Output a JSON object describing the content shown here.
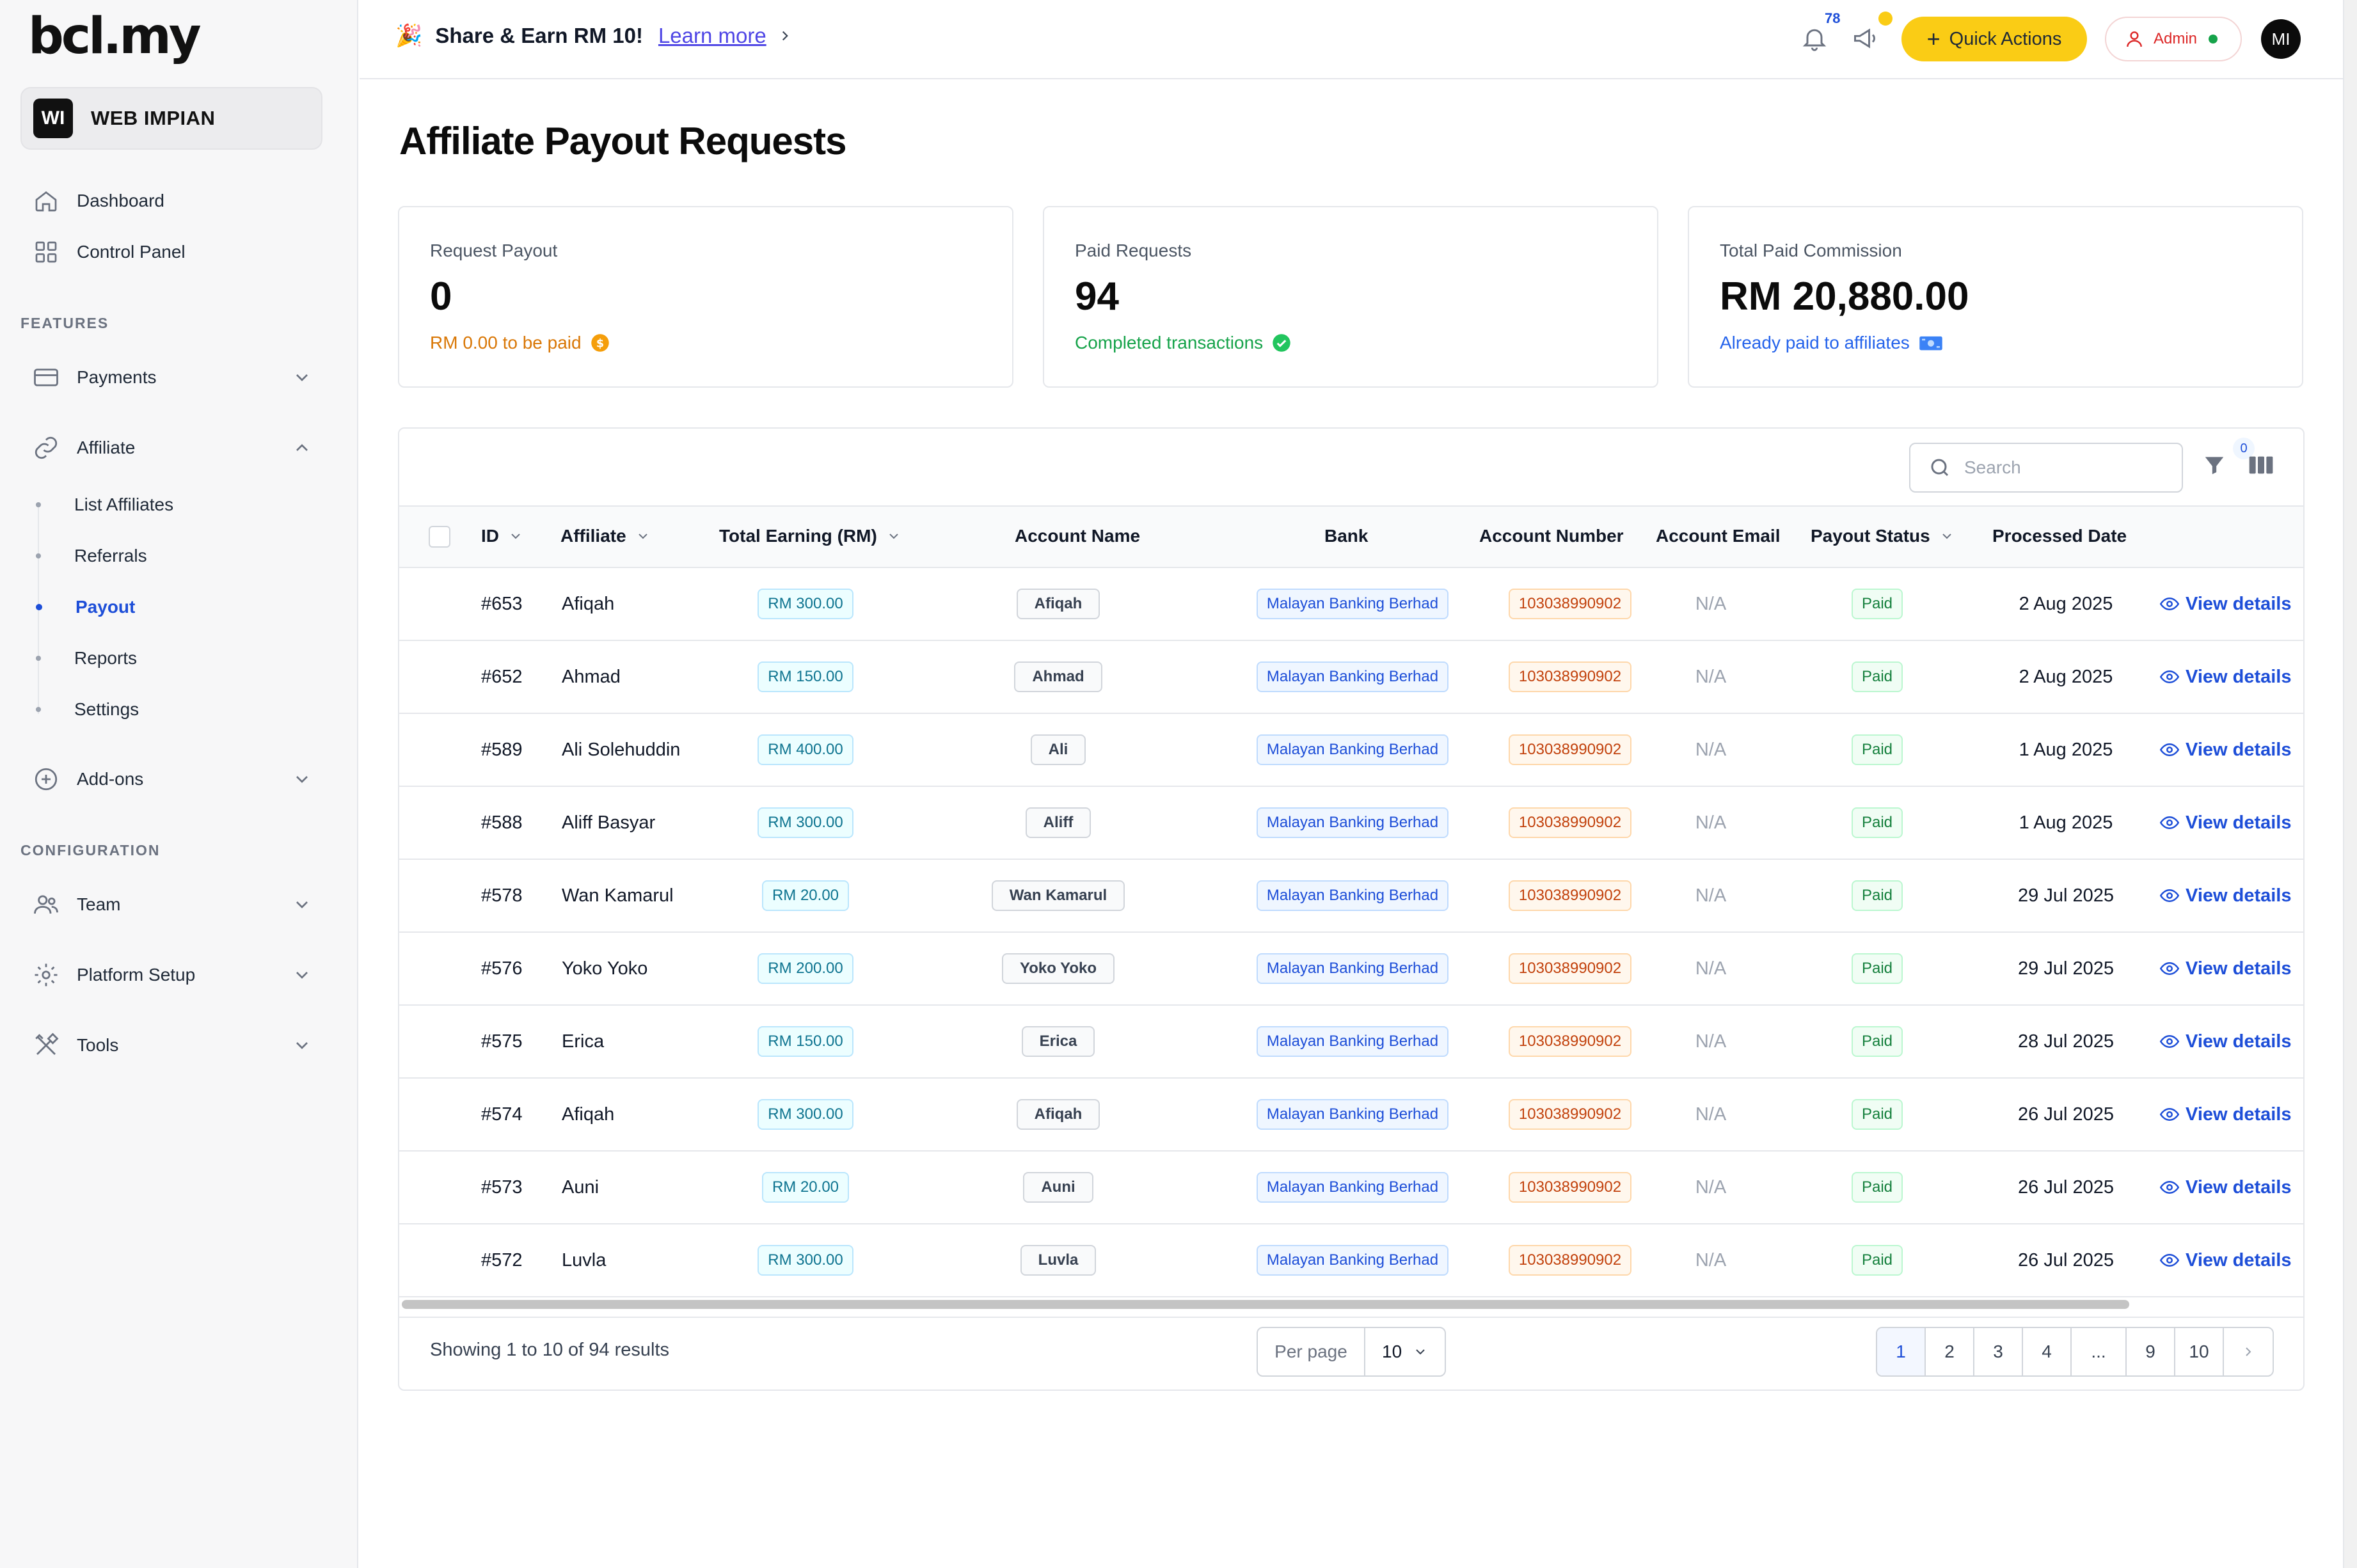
{
  "app": {
    "logo": "bcl.my",
    "workspace": {
      "initials": "WI",
      "name": "WEB IMPIAN"
    }
  },
  "sidebar": {
    "dashboard": "Dashboard",
    "control_panel": "Control Panel",
    "features_label": "FEATURES",
    "payments": "Payments",
    "affiliate": "Affiliate",
    "affiliate_sub": {
      "list": "List Affiliates",
      "referrals": "Referrals",
      "payout": "Payout",
      "reports": "Reports",
      "settings": "Settings"
    },
    "addons": "Add-ons",
    "configuration_label": "CONFIGURATION",
    "team": "Team",
    "platform_setup": "Platform Setup",
    "tools": "Tools"
  },
  "topbar": {
    "promo_text": "Share & Earn RM 10!",
    "promo_link": "Learn more",
    "notification_count": "78",
    "quick_actions": "Quick Actions",
    "admin_label": "Admin",
    "avatar_initials": "MI"
  },
  "page": {
    "title": "Affiliate Payout Requests"
  },
  "cards": {
    "request": {
      "label": "Request Payout",
      "value": "0",
      "sub": "RM 0.00 to be paid",
      "color": "#d97706"
    },
    "paid": {
      "label": "Paid Requests",
      "value": "94",
      "sub": "Completed transactions",
      "color": "#16a34a"
    },
    "total": {
      "label": "Total Paid Commission",
      "value": "RM 20,880.00",
      "sub": "Already paid to affiliates",
      "color": "#2563eb"
    }
  },
  "table": {
    "search_placeholder": "Search",
    "filter_count": "0",
    "headers": {
      "id": "ID",
      "affiliate": "Affiliate",
      "earning": "Total Earning (RM)",
      "account_name": "Account Name",
      "bank": "Bank",
      "account_number": "Account Number",
      "account_email": "Account Email",
      "status": "Payout Status",
      "processed": "Processed Date"
    },
    "rows": [
      {
        "id": "#653",
        "affiliate": "Afiqah",
        "earning": "RM 300.00",
        "account_name": "Afiqah",
        "bank": "Malayan Banking Berhad",
        "account_number": "103038990902",
        "email": "N/A",
        "status": "Paid",
        "date": "2 Aug 2025",
        "action": "View details"
      },
      {
        "id": "#652",
        "affiliate": "Ahmad",
        "earning": "RM 150.00",
        "account_name": "Ahmad",
        "bank": "Malayan Banking Berhad",
        "account_number": "103038990902",
        "email": "N/A",
        "status": "Paid",
        "date": "2 Aug 2025",
        "action": "View details"
      },
      {
        "id": "#589",
        "affiliate": "Ali Solehuddin",
        "earning": "RM 400.00",
        "account_name": "Ali",
        "bank": "Malayan Banking Berhad",
        "account_number": "103038990902",
        "email": "N/A",
        "status": "Paid",
        "date": "1 Aug 2025",
        "action": "View details"
      },
      {
        "id": "#588",
        "affiliate": "Aliff Basyar",
        "earning": "RM 300.00",
        "account_name": "Aliff",
        "bank": "Malayan Banking Berhad",
        "account_number": "103038990902",
        "email": "N/A",
        "status": "Paid",
        "date": "1 Aug 2025",
        "action": "View details"
      },
      {
        "id": "#578",
        "affiliate": "Wan Kamarul",
        "earning": "RM 20.00",
        "account_name": "Wan Kamarul",
        "bank": "Malayan Banking Berhad",
        "account_number": "103038990902",
        "email": "N/A",
        "status": "Paid",
        "date": "29 Jul 2025",
        "action": "View details"
      },
      {
        "id": "#576",
        "affiliate": "Yoko Yoko",
        "earning": "RM 200.00",
        "account_name": "Yoko Yoko",
        "bank": "Malayan Banking Berhad",
        "account_number": "103038990902",
        "email": "N/A",
        "status": "Paid",
        "date": "29 Jul 2025",
        "action": "View details"
      },
      {
        "id": "#575",
        "affiliate": "Erica",
        "earning": "RM 150.00",
        "account_name": "Erica",
        "bank": "Malayan Banking Berhad",
        "account_number": "103038990902",
        "email": "N/A",
        "status": "Paid",
        "date": "28 Jul 2025",
        "action": "View details"
      },
      {
        "id": "#574",
        "affiliate": "Afiqah",
        "earning": "RM 300.00",
        "account_name": "Afiqah",
        "bank": "Malayan Banking Berhad",
        "account_number": "103038990902",
        "email": "N/A",
        "status": "Paid",
        "date": "26 Jul 2025",
        "action": "View details"
      },
      {
        "id": "#573",
        "affiliate": "Auni",
        "earning": "RM 20.00",
        "account_name": "Auni",
        "bank": "Malayan Banking Berhad",
        "account_number": "103038990902",
        "email": "N/A",
        "status": "Paid",
        "date": "26 Jul 2025",
        "action": "View details"
      },
      {
        "id": "#572",
        "affiliate": "Luvla",
        "earning": "RM 300.00",
        "account_name": "Luvla",
        "bank": "Malayan Banking Berhad",
        "account_number": "103038990902",
        "email": "N/A",
        "status": "Paid",
        "date": "26 Jul 2025",
        "action": "View details"
      }
    ],
    "showing": "Showing 1 to 10 of 94 results",
    "per_page_label": "Per page",
    "per_page_value": "10",
    "pages": [
      "1",
      "2",
      "3",
      "4",
      "...",
      "9",
      "10"
    ]
  }
}
